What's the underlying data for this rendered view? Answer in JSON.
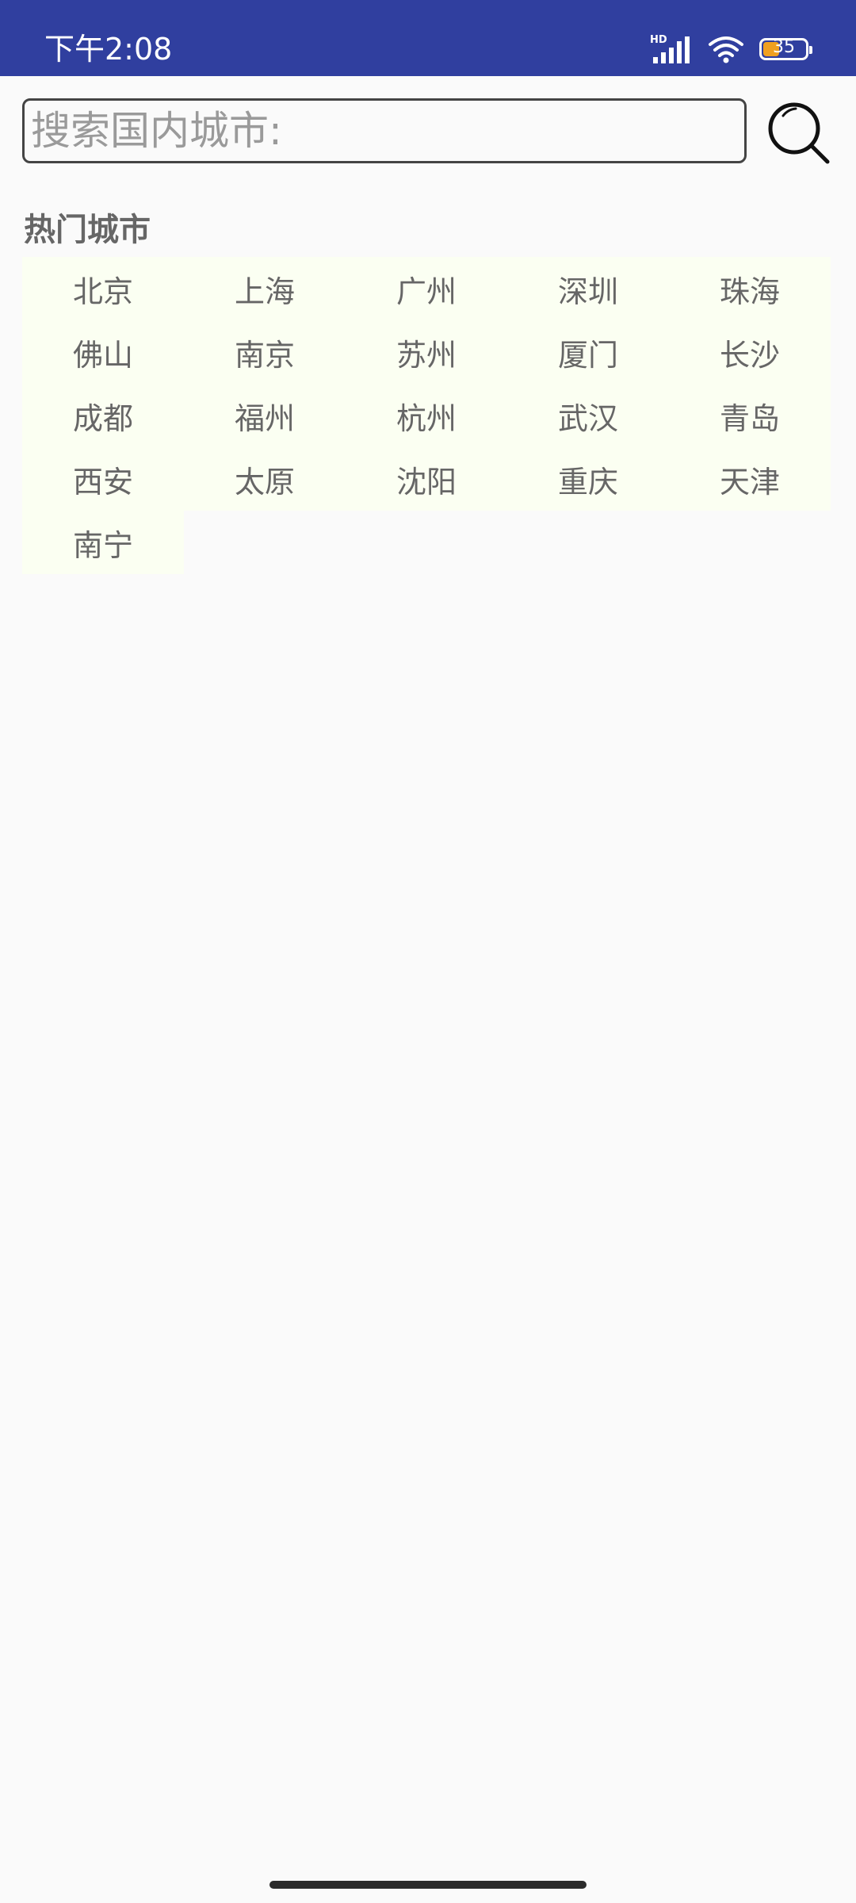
{
  "status_bar": {
    "time": "下午2:08",
    "network_label": "HD",
    "battery_level": "35",
    "battery_fraction": 0.35,
    "icons": [
      "signal-icon",
      "wifi-icon",
      "battery-icon"
    ]
  },
  "search": {
    "placeholder": "搜索国内城市:",
    "value": "",
    "button_icon": "search-icon"
  },
  "hot_cities": {
    "title": "热门城市",
    "items": [
      "北京",
      "上海",
      "广州",
      "深圳",
      "珠海",
      "佛山",
      "南京",
      "苏州",
      "厦门",
      "长沙",
      "成都",
      "福州",
      "杭州",
      "武汉",
      "青岛",
      "西安",
      "太原",
      "沈阳",
      "重庆",
      "天津",
      "南宁"
    ]
  },
  "colors": {
    "status_bar": "#303f9f",
    "background": "#fafafa",
    "cell_background": "#fbfff2",
    "text": "#666666"
  }
}
